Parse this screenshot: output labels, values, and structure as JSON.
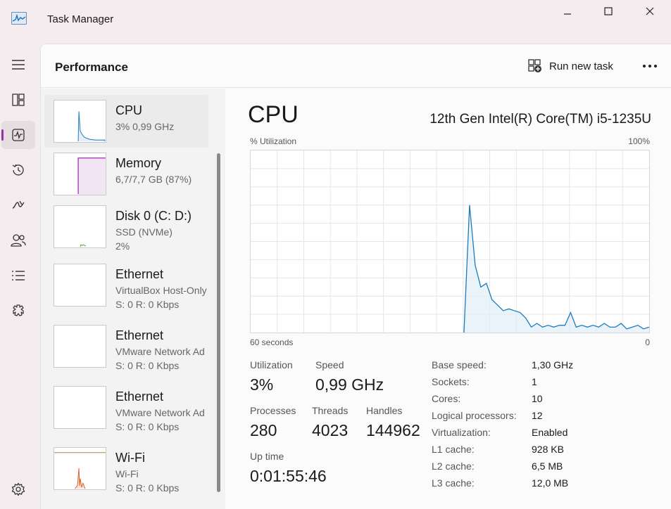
{
  "app": {
    "title": "Task Manager"
  },
  "nav": {
    "items": [
      {
        "icon": "hamburger-menu-icon"
      },
      {
        "icon": "processes-icon"
      },
      {
        "icon": "performance-icon",
        "active": true
      },
      {
        "icon": "app-history-icon"
      },
      {
        "icon": "startup-apps-icon"
      },
      {
        "icon": "users-icon"
      },
      {
        "icon": "details-icon"
      },
      {
        "icon": "services-icon"
      },
      {
        "icon": "settings-icon"
      }
    ]
  },
  "header": {
    "title": "Performance",
    "run_task_label": "Run new task",
    "more_label": "•••"
  },
  "resources": [
    {
      "name": "CPU",
      "line1": "3%  0,99 GHz",
      "line2": ""
    },
    {
      "name": "Memory",
      "line1": "6,7/7,7 GB (87%)",
      "line2": ""
    },
    {
      "name": "Disk 0 (C: D:)",
      "line1": "SSD (NVMe)",
      "line2": "2%"
    },
    {
      "name": "Ethernet",
      "line1": "VirtualBox Host-Only",
      "line2": "S: 0 R: 0 Kbps"
    },
    {
      "name": "Ethernet",
      "line1": "VMware Network Ad",
      "line2": "S: 0 R: 0 Kbps"
    },
    {
      "name": "Ethernet",
      "line1": "VMware Network Ad",
      "line2": "S: 0 R: 0 Kbps"
    },
    {
      "name": "Wi-Fi",
      "line1": "Wi-Fi",
      "line2": "S: 0 R: 0 Kbps"
    }
  ],
  "detail": {
    "title": "CPU",
    "model": "12th Gen Intel(R) Core(TM) i5-1235U",
    "graph": {
      "y_label": "% Utilization",
      "y_max_label": "100%",
      "x_left_label": "60 seconds",
      "x_right_label": "0",
      "utilization_series": [
        0,
        0,
        0,
        0,
        0,
        0,
        0,
        0,
        0,
        0,
        0,
        0,
        0,
        0,
        0,
        0,
        0,
        0,
        0,
        0,
        0,
        0,
        0,
        0,
        0,
        0,
        0,
        0,
        0,
        0,
        0,
        0,
        0,
        0,
        0,
        0,
        0,
        0,
        0,
        70,
        37,
        25,
        27,
        18,
        15,
        12,
        13,
        12,
        11,
        8,
        3,
        5,
        3,
        4,
        3,
        4,
        4,
        11,
        3,
        4,
        3,
        4,
        3,
        5,
        3,
        3,
        5,
        2,
        3,
        4,
        2,
        3
      ],
      "accent": "#1b7bbd"
    },
    "stats": {
      "utilization_label": "Utilization",
      "utilization": "3%",
      "speed_label": "Speed",
      "speed": "0,99 GHz",
      "processes_label": "Processes",
      "processes": "280",
      "threads_label": "Threads",
      "threads": "4023",
      "handles_label": "Handles",
      "handles": "144962",
      "uptime_label": "Up time",
      "uptime": "0:01:55:46"
    },
    "info": [
      {
        "label": "Base speed:",
        "value": "1,30 GHz"
      },
      {
        "label": "Sockets:",
        "value": "1"
      },
      {
        "label": "Cores:",
        "value": "10"
      },
      {
        "label": "Logical processors:",
        "value": "12"
      },
      {
        "label": "Virtualization:",
        "value": "Enabled"
      },
      {
        "label": "L1 cache:",
        "value": "928 KB"
      },
      {
        "label": "L2 cache:",
        "value": "6,5 MB"
      },
      {
        "label": "L3 cache:",
        "value": "12,0 MB"
      }
    ]
  }
}
